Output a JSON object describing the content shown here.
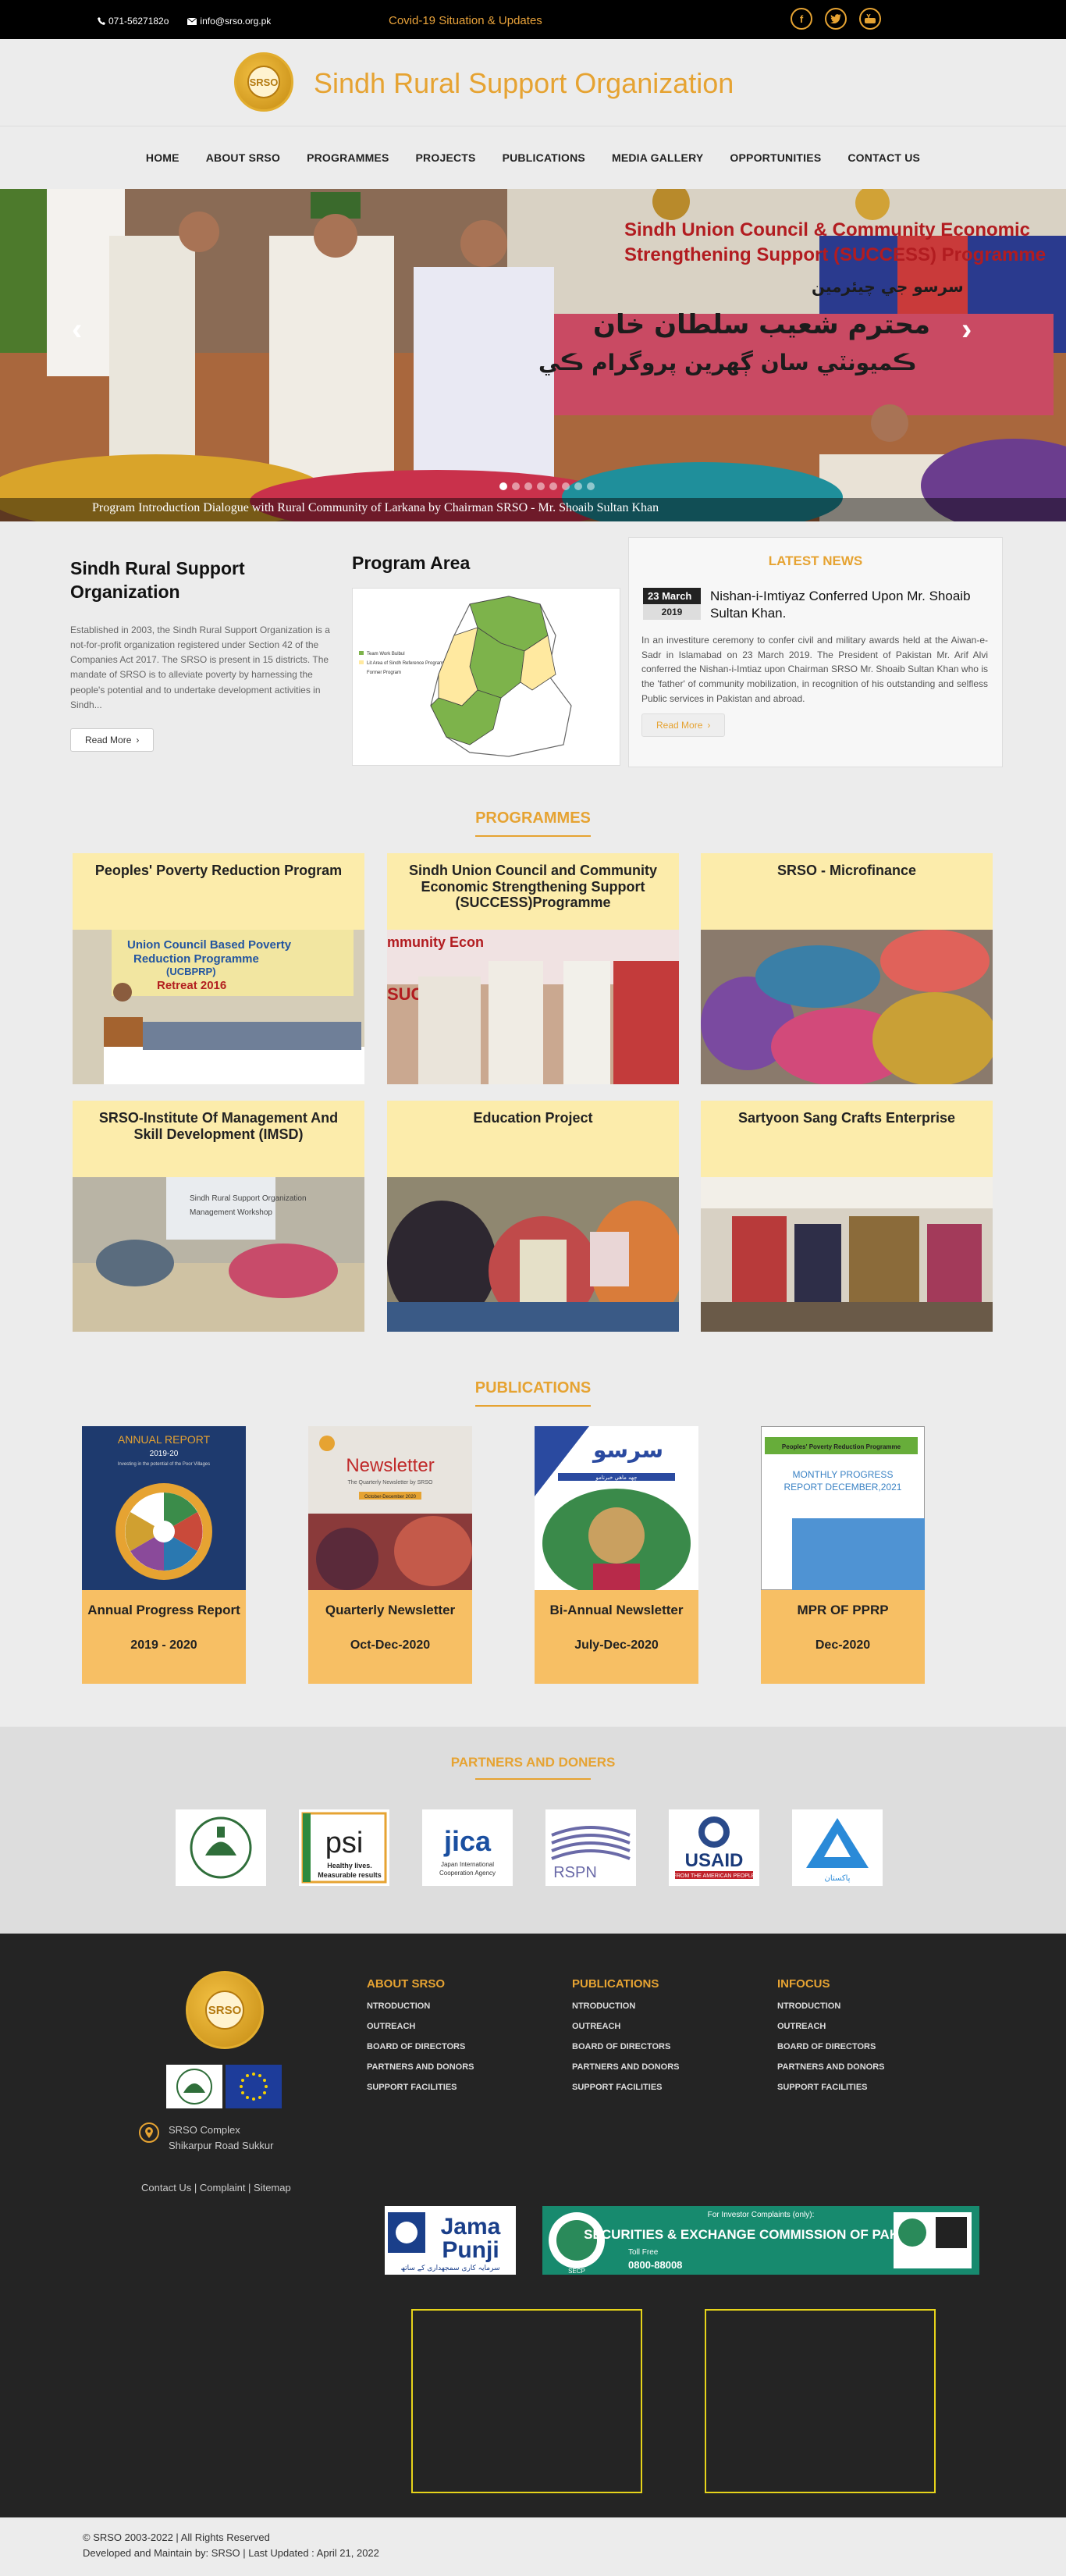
{
  "topbar": {
    "phone": "071-5627182o",
    "email": "info@srso.org.pk",
    "covid_link": "Covid-19 Situation & Updates",
    "social_icons": [
      "facebook-icon",
      "twitter-icon",
      "youtube-icon"
    ]
  },
  "header": {
    "logo_text": "SRSO",
    "title": "Sindh Rural Support Organization"
  },
  "nav": {
    "items": [
      "HOME",
      "ABOUT SRSO",
      "PROGRAMMES",
      "PROJECTS",
      "PUBLICATIONS",
      "MEDIA GALLERY",
      "OPPORTUNITIES",
      "CONTACT US"
    ]
  },
  "hero": {
    "caption": "Program Introduction Dialogue with Rural Community of Larkana by Chairman SRSO - Mr. Shoaib Sultan Khan",
    "banner_line1": "Sindh Union Council & Community Economic",
    "banner_line2": "Strengthening Support (SUCCESS) Programme",
    "banner_urdu1": "سرسو جي چيئرمين",
    "banner_urdu2": "محترم شعيب سلطان خان",
    "banner_urdu3": "ڪميونٽي سان ڳهرين پروگرام ڪي",
    "prev": "‹",
    "next": "›",
    "slide_count": 8
  },
  "about": {
    "heading": "Sindh Rural Support Organization",
    "text": "Established in 2003, the Sindh Rural Support Organization is a not-for-profit organization registered under Section 42 of the Companies Act 2017. The SRSO is present in 15 districts. The mandate of SRSO is to alleviate poverty by harnessing the people's potential and to undertake development activities in Sindh...",
    "button": "Read More"
  },
  "program_area": {
    "heading": "Program Area",
    "legend": [
      "Team Work Bulbul",
      "Lit Area of Sindh Reference Program",
      "Former Program"
    ]
  },
  "news": {
    "heading": "LATEST NEWS",
    "date_day": "23 March",
    "date_year": "2019",
    "title": "Nishan-i-Imtiyaz Conferred Upon Mr. Shoaib Sultan Khan.",
    "text": "In an investiture ceremony to confer civil and military awards held at the Aiwan-e-Sadr in Islamabad on 23 March 2019. The President of Pakistan Mr. Arif Alvi conferred the Nishan-i-Imtiaz upon Chairman SRSO Mr. Shoaib Sultan Khan who is the 'father' of community mobilization, in recognition of his outstanding and selfless Public services in Pakistan and abroad.",
    "button": "Read More"
  },
  "programmes": {
    "heading": "PROGRAMMES",
    "items": [
      {
        "title": "Peoples' Poverty Reduction Program",
        "img_text1": "Union Council Based Poverty",
        "img_text2": "Reduction Programme",
        "img_text3": "(UCBPRP)",
        "img_text4": "Retreat 2016"
      },
      {
        "title": "Sindh Union Council and Community Economic Strengthening Support (SUCCESS)Programme",
        "img_text1": "mmunity Econ",
        "img_text2": "SUCCES"
      },
      {
        "title": "SRSO - Microfinance"
      },
      {
        "title": "SRSO-Institute Of Management And Skill Development (IMSD)",
        "img_text1": "Sindh Rural Support Organization",
        "img_text2": "Management Workshop"
      },
      {
        "title": "Education Project"
      },
      {
        "title": "Sartyoon Sang Crafts Enterprise"
      }
    ]
  },
  "publications": {
    "heading": "PUBLICATIONS",
    "items": [
      {
        "title": "Annual Progress Report",
        "period": "2019 - 2020",
        "cover_title": "ANNUAL REPORT",
        "cover_sub": "2019-20",
        "cover_sub2": "Investing in the potential of the Poor Villages"
      },
      {
        "title": "Quarterly Newsletter",
        "period": "Oct-Dec-2020",
        "cover_title": "Newsletter",
        "cover_sub": "The Quarterly Newsletter by SRSO",
        "cover_sub2": "October-December 2020"
      },
      {
        "title": "Bi-Annual Newsletter",
        "period": "July-Dec-2020",
        "cover_title": "سرسو",
        "cover_sub": "ڇهه ماهي خبرنامو"
      },
      {
        "title": "MPR OF PPRP",
        "period": "Dec-2020",
        "cover_title": "Peoples' Poverty Reduction Programme",
        "cover_sub": "MONTHLY PROGRESS",
        "cover_sub2": "REPORT DECEMBER,2021"
      }
    ]
  },
  "partners": {
    "heading": "PARTNERS AND DONERS",
    "logos": {
      "psi": "psi",
      "psi_tag1": "Healthy lives.",
      "psi_tag2": "Measurable results",
      "jica": "jica",
      "jica_tag1": "Japan International",
      "jica_tag2": "Cooperation Agency",
      "rspn": "RSPN",
      "usaid": "USAID",
      "usaid_tag": "FROM THE AMERICAN PEOPLE",
      "ppaf": "پاکستان"
    }
  },
  "footer": {
    "logo_text": "SRSO",
    "address1": "SRSO Complex",
    "address2": "Shikarpur Road Sukkur",
    "links": "Contact Us | Complaint | Sitemap",
    "columns": [
      {
        "title": "ABOUT SRSO",
        "items": [
          "NTRODUCTION",
          "OUTREACH",
          "BOARD OF DIRECTORS",
          "PARTNERS AND DONORS",
          "SUPPORT FACILITIES"
        ]
      },
      {
        "title": "PUBLICATIONS",
        "items": [
          "NTRODUCTION",
          "OUTREACH",
          "BOARD OF DIRECTORS",
          "PARTNERS AND DONORS",
          "SUPPORT FACILITIES"
        ]
      },
      {
        "title": "INFOCUS",
        "items": [
          "NTRODUCTION",
          "OUTREACH",
          "BOARD OF DIRECTORS",
          "PARTNERS AND DONORS",
          "SUPPORT FACILITIES"
        ]
      }
    ],
    "jama": {
      "line1": "Jama",
      "line2": "Punji",
      "urdu": "سرمایہ کاری سمجھداری کے ساتھ"
    },
    "secp": {
      "top": "For Investor Complaints (only):",
      "name": "SECURITIES & EXCHANGE COMMISSION OF PAKISTAN",
      "phone": "0800-88008",
      "toll": "Toll Free",
      "label": "SECP"
    }
  },
  "bottom": {
    "copyright": "© SRSO 2003-2022 | All Rights Reserved",
    "maintained": "Developed and Maintain by: SRSO | Last Updated : April 21, 2022"
  }
}
